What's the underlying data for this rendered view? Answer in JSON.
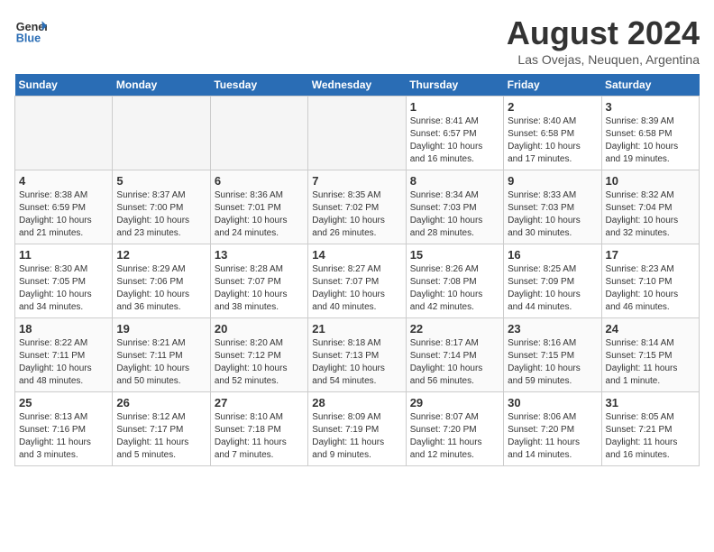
{
  "header": {
    "logo_general": "General",
    "logo_blue": "Blue",
    "title": "August 2024",
    "subtitle": "Las Ovejas, Neuquen, Argentina"
  },
  "days_of_week": [
    "Sunday",
    "Monday",
    "Tuesday",
    "Wednesday",
    "Thursday",
    "Friday",
    "Saturday"
  ],
  "weeks": [
    [
      {
        "day": "",
        "empty": true
      },
      {
        "day": "",
        "empty": true
      },
      {
        "day": "",
        "empty": true
      },
      {
        "day": "",
        "empty": true
      },
      {
        "day": "1",
        "info": "Sunrise: 8:41 AM\nSunset: 6:57 PM\nDaylight: 10 hours\nand 16 minutes."
      },
      {
        "day": "2",
        "info": "Sunrise: 8:40 AM\nSunset: 6:58 PM\nDaylight: 10 hours\nand 17 minutes."
      },
      {
        "day": "3",
        "info": "Sunrise: 8:39 AM\nSunset: 6:58 PM\nDaylight: 10 hours\nand 19 minutes."
      }
    ],
    [
      {
        "day": "4",
        "info": "Sunrise: 8:38 AM\nSunset: 6:59 PM\nDaylight: 10 hours\nand 21 minutes."
      },
      {
        "day": "5",
        "info": "Sunrise: 8:37 AM\nSunset: 7:00 PM\nDaylight: 10 hours\nand 23 minutes."
      },
      {
        "day": "6",
        "info": "Sunrise: 8:36 AM\nSunset: 7:01 PM\nDaylight: 10 hours\nand 24 minutes."
      },
      {
        "day": "7",
        "info": "Sunrise: 8:35 AM\nSunset: 7:02 PM\nDaylight: 10 hours\nand 26 minutes."
      },
      {
        "day": "8",
        "info": "Sunrise: 8:34 AM\nSunset: 7:03 PM\nDaylight: 10 hours\nand 28 minutes."
      },
      {
        "day": "9",
        "info": "Sunrise: 8:33 AM\nSunset: 7:03 PM\nDaylight: 10 hours\nand 30 minutes."
      },
      {
        "day": "10",
        "info": "Sunrise: 8:32 AM\nSunset: 7:04 PM\nDaylight: 10 hours\nand 32 minutes."
      }
    ],
    [
      {
        "day": "11",
        "info": "Sunrise: 8:30 AM\nSunset: 7:05 PM\nDaylight: 10 hours\nand 34 minutes."
      },
      {
        "day": "12",
        "info": "Sunrise: 8:29 AM\nSunset: 7:06 PM\nDaylight: 10 hours\nand 36 minutes."
      },
      {
        "day": "13",
        "info": "Sunrise: 8:28 AM\nSunset: 7:07 PM\nDaylight: 10 hours\nand 38 minutes."
      },
      {
        "day": "14",
        "info": "Sunrise: 8:27 AM\nSunset: 7:07 PM\nDaylight: 10 hours\nand 40 minutes."
      },
      {
        "day": "15",
        "info": "Sunrise: 8:26 AM\nSunset: 7:08 PM\nDaylight: 10 hours\nand 42 minutes."
      },
      {
        "day": "16",
        "info": "Sunrise: 8:25 AM\nSunset: 7:09 PM\nDaylight: 10 hours\nand 44 minutes."
      },
      {
        "day": "17",
        "info": "Sunrise: 8:23 AM\nSunset: 7:10 PM\nDaylight: 10 hours\nand 46 minutes."
      }
    ],
    [
      {
        "day": "18",
        "info": "Sunrise: 8:22 AM\nSunset: 7:11 PM\nDaylight: 10 hours\nand 48 minutes."
      },
      {
        "day": "19",
        "info": "Sunrise: 8:21 AM\nSunset: 7:11 PM\nDaylight: 10 hours\nand 50 minutes."
      },
      {
        "day": "20",
        "info": "Sunrise: 8:20 AM\nSunset: 7:12 PM\nDaylight: 10 hours\nand 52 minutes."
      },
      {
        "day": "21",
        "info": "Sunrise: 8:18 AM\nSunset: 7:13 PM\nDaylight: 10 hours\nand 54 minutes."
      },
      {
        "day": "22",
        "info": "Sunrise: 8:17 AM\nSunset: 7:14 PM\nDaylight: 10 hours\nand 56 minutes."
      },
      {
        "day": "23",
        "info": "Sunrise: 8:16 AM\nSunset: 7:15 PM\nDaylight: 10 hours\nand 59 minutes."
      },
      {
        "day": "24",
        "info": "Sunrise: 8:14 AM\nSunset: 7:15 PM\nDaylight: 11 hours\nand 1 minute."
      }
    ],
    [
      {
        "day": "25",
        "info": "Sunrise: 8:13 AM\nSunset: 7:16 PM\nDaylight: 11 hours\nand 3 minutes."
      },
      {
        "day": "26",
        "info": "Sunrise: 8:12 AM\nSunset: 7:17 PM\nDaylight: 11 hours\nand 5 minutes."
      },
      {
        "day": "27",
        "info": "Sunrise: 8:10 AM\nSunset: 7:18 PM\nDaylight: 11 hours\nand 7 minutes."
      },
      {
        "day": "28",
        "info": "Sunrise: 8:09 AM\nSunset: 7:19 PM\nDaylight: 11 hours\nand 9 minutes."
      },
      {
        "day": "29",
        "info": "Sunrise: 8:07 AM\nSunset: 7:20 PM\nDaylight: 11 hours\nand 12 minutes."
      },
      {
        "day": "30",
        "info": "Sunrise: 8:06 AM\nSunset: 7:20 PM\nDaylight: 11 hours\nand 14 minutes."
      },
      {
        "day": "31",
        "info": "Sunrise: 8:05 AM\nSunset: 7:21 PM\nDaylight: 11 hours\nand 16 minutes."
      }
    ]
  ]
}
